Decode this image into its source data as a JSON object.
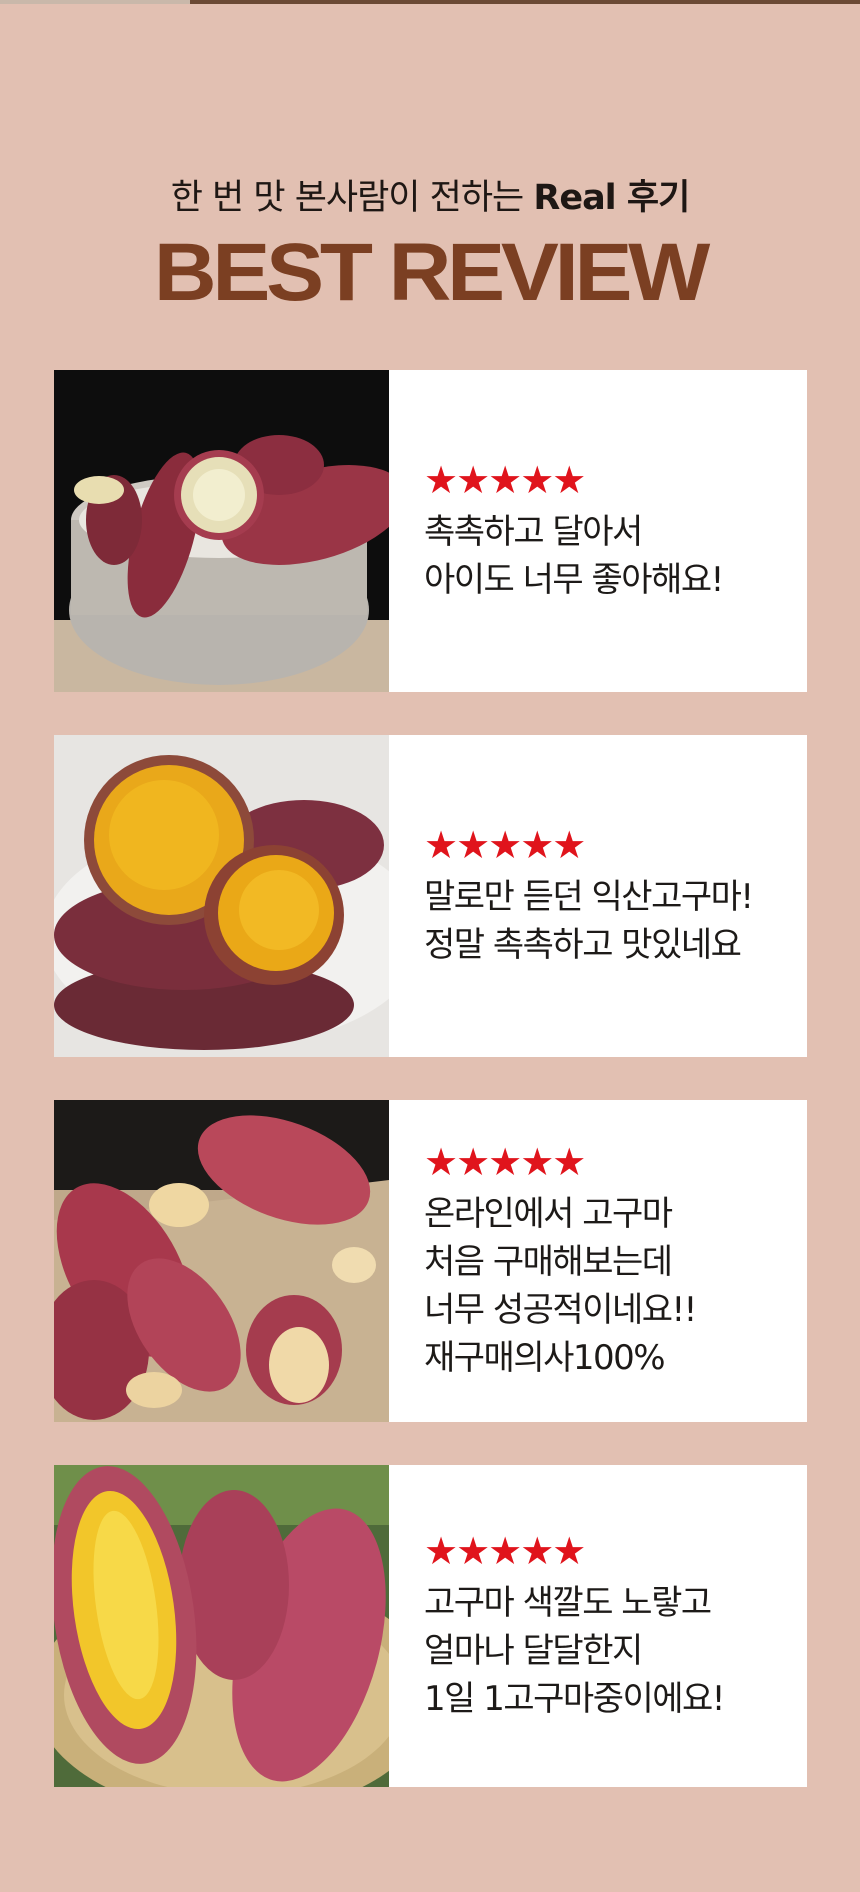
{
  "header": {
    "subtitle": "한 번 맛 본사람이 전하는 ",
    "subtitle_bold": "Real 후기",
    "title": "BEST REVIEW"
  },
  "reviews": [
    {
      "stars": "★★★★★",
      "rating": 5,
      "lines": [
        "촉촉하고 달아서",
        "아이도 너무 좋아해요!"
      ]
    },
    {
      "stars": "★★★★★",
      "rating": 5,
      "lines": [
        "말로만 듣던 익산고구마!",
        "정말 촉촉하고 맛있네요"
      ]
    },
    {
      "stars": "★★★★★",
      "rating": 5,
      "lines": [
        "온라인에서 고구마",
        "처음 구매해보는데",
        "너무 성공적이네요!!",
        "재구매의사100%"
      ]
    },
    {
      "stars": "★★★★★",
      "rating": 5,
      "lines": [
        "고구마 색깔도 노랗고",
        "얼마나 달달한지",
        "1일 1고구마중이에요!"
      ]
    }
  ],
  "colors": {
    "background": "#e2c0b2",
    "title": "#7b3f22",
    "stars": "#e0141c"
  }
}
